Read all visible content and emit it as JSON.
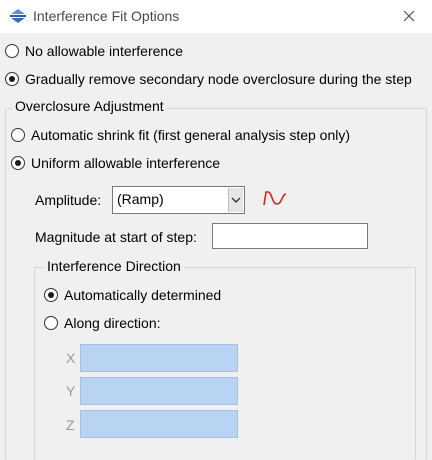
{
  "window": {
    "title": "Interference Fit Options",
    "title_icon": "interference-fit-icon",
    "close_icon": "close-icon"
  },
  "options": {
    "no_allowable": {
      "label": "No allowable interference",
      "checked": false
    },
    "gradually_remove": {
      "label": "Gradually remove secondary node overclosure during the step",
      "checked": true
    }
  },
  "overclosure": {
    "title": "Overclosure Adjustment",
    "automatic_shrink": {
      "label": "Automatic shrink fit (first general analysis step only)",
      "checked": false
    },
    "uniform": {
      "label": "Uniform allowable interference",
      "checked": true
    },
    "amplitude": {
      "label": "Amplitude:",
      "value": "(Ramp)",
      "curve_icon": "amplitude-curve-icon"
    },
    "magnitude": {
      "label": "Magnitude at start of step:",
      "value": ""
    }
  },
  "interference_direction": {
    "title": "Interference Direction",
    "auto": {
      "label": "Automatically determined",
      "checked": true
    },
    "along": {
      "label": "Along direction:",
      "checked": false
    },
    "x": {
      "label": "X",
      "value": ""
    },
    "y": {
      "label": "Y",
      "value": ""
    },
    "z": {
      "label": "Z",
      "value": ""
    }
  },
  "colors": {
    "dialog_bg": "#f0f0f0",
    "disabled_field": "#b9d3f2",
    "curve_red": "#d0261e"
  }
}
